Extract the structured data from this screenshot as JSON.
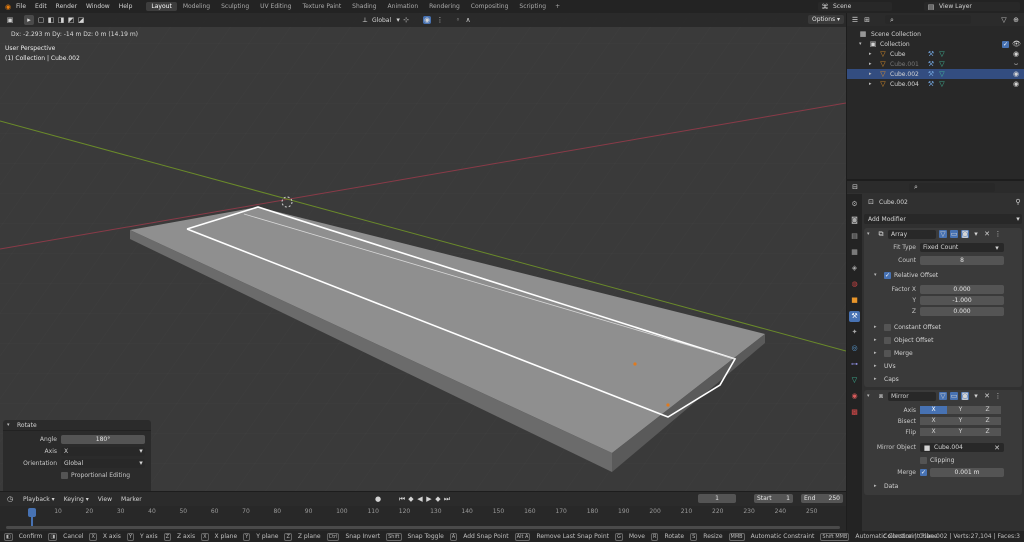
{
  "menu": {
    "items": [
      "File",
      "Edit",
      "Render",
      "Window",
      "Help"
    ],
    "workspaces": [
      "Layout",
      "Modeling",
      "Sculpting",
      "UV Editing",
      "Texture Paint",
      "Shading",
      "Animation",
      "Rendering",
      "Compositing",
      "Scripting"
    ],
    "add_tab": "+",
    "scene": "Scene",
    "view_layer": "View Layer"
  },
  "viewport": {
    "status": "Dx: -2.293 m  Dy: -14 m  Dz: 0 m (14.19 m)",
    "view_name": "User Perspective",
    "collection_info": "(1) Collection | Cube.002",
    "orientation": "Global",
    "options": "Options ▾"
  },
  "rotate_panel": {
    "title": "Rotate",
    "angle_label": "Angle",
    "angle_value": "180°",
    "axis_label": "Axis",
    "axis_value": "X",
    "orientation_label": "Orientation",
    "orientation_value": "Global",
    "proportional_label": "Proportional Editing"
  },
  "outliner": {
    "root": "Scene Collection",
    "collection": "Collection",
    "items": [
      {
        "name": "Cube",
        "selected": false,
        "dim": false
      },
      {
        "name": "Cube.001",
        "selected": false,
        "dim": true
      },
      {
        "name": "Cube.002",
        "selected": true,
        "dim": false
      },
      {
        "name": "Cube.004",
        "selected": false,
        "dim": false
      }
    ]
  },
  "properties": {
    "object_name": "Cube.002",
    "add_modifier": "Add Modifier",
    "array": {
      "name": "Array",
      "fit_type_label": "Fit Type",
      "fit_type": "Fixed Count",
      "count_label": "Count",
      "count": "8",
      "relative_offset": "Relative Offset",
      "factor_x_label": "Factor X",
      "factor_x": "0.000",
      "y_label": "Y",
      "y": "-1.000",
      "z_label": "Z",
      "z": "0.000",
      "constant_offset": "Constant Offset",
      "object_offset": "Object Offset",
      "merge": "Merge",
      "uvs": "UVs",
      "caps": "Caps"
    },
    "mirror": {
      "name": "Mirror",
      "axis_label": "Axis",
      "bisect_label": "Bisect",
      "flip_label": "Flip",
      "x": "X",
      "y": "Y",
      "z": "Z",
      "mirror_object_label": "Mirror Object",
      "mirror_object": "Cube.004",
      "clipping": "Clipping",
      "merge_label": "Merge",
      "merge_value": "0.001 m",
      "data": "Data"
    }
  },
  "timeline": {
    "playback": "Playback ▾",
    "keying": "Keying ▾",
    "view": "View",
    "marker": "Marker",
    "current_frame": "1",
    "start_label": "Start",
    "start": "1",
    "end_label": "End",
    "end": "250",
    "ticks": [
      "1",
      "10",
      "20",
      "30",
      "40",
      "50",
      "60",
      "70",
      "80",
      "90",
      "100",
      "110",
      "120",
      "130",
      "140",
      "150",
      "160",
      "170",
      "180",
      "190",
      "200",
      "210",
      "220",
      "230",
      "240",
      "250"
    ]
  },
  "statusbar": {
    "items": [
      "Confirm",
      "Cancel",
      "X axis",
      "Y axis",
      "Z axis",
      "X plane",
      "Y plane",
      "Z plane",
      "Snap Invert",
      "Snap Toggle",
      "Add Snap Point",
      "Remove Last Snap Point",
      "Move",
      "Rotate",
      "Resize",
      "Automatic Constraint",
      "Automatic Constraint Plane"
    ],
    "keys": [
      "X",
      "Y",
      "Z",
      "X",
      "Y",
      "Z",
      "Ctrl",
      "Shift",
      "A",
      "Alt A",
      "G",
      "R",
      "S",
      "MMB",
      "Shift MMB"
    ],
    "info": "Collection | Cube.002 | Verts:27,104 | Faces:3"
  },
  "colors": {
    "accent": "#4772b3",
    "active_tab": "#3d3d3d",
    "selection_outline": "#ffffff",
    "x_axis": "#8a3a48",
    "y_axis": "#6a8a2a",
    "header": "#2b2b2b"
  }
}
